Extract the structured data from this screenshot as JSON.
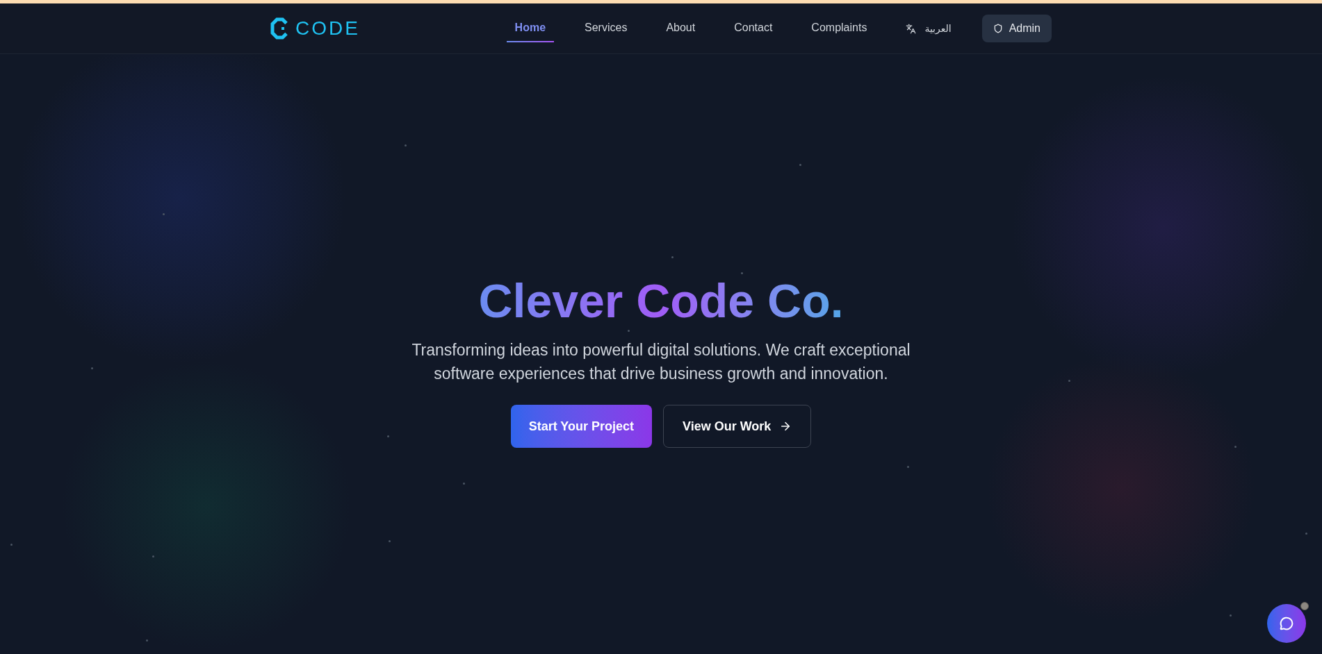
{
  "header": {
    "logo": {
      "text": "CODE"
    },
    "nav": [
      {
        "label": "Home",
        "selected": true
      },
      {
        "label": "Services",
        "selected": false
      },
      {
        "label": "About",
        "selected": false
      },
      {
        "label": "Contact",
        "selected": false
      },
      {
        "label": "Complaints",
        "selected": false
      }
    ],
    "language_switch": {
      "label": "العربية"
    },
    "admin_button": {
      "label": "Admin"
    }
  },
  "hero": {
    "title": "Clever Code Co.",
    "subtitle": "Transforming ideas into powerful digital solutions. We craft exceptional software experiences that drive business growth and innovation.",
    "buttons": [
      {
        "label": "Start Your Project",
        "kind": "primary"
      },
      {
        "label": "View Our Work",
        "kind": "outline"
      }
    ]
  }
}
